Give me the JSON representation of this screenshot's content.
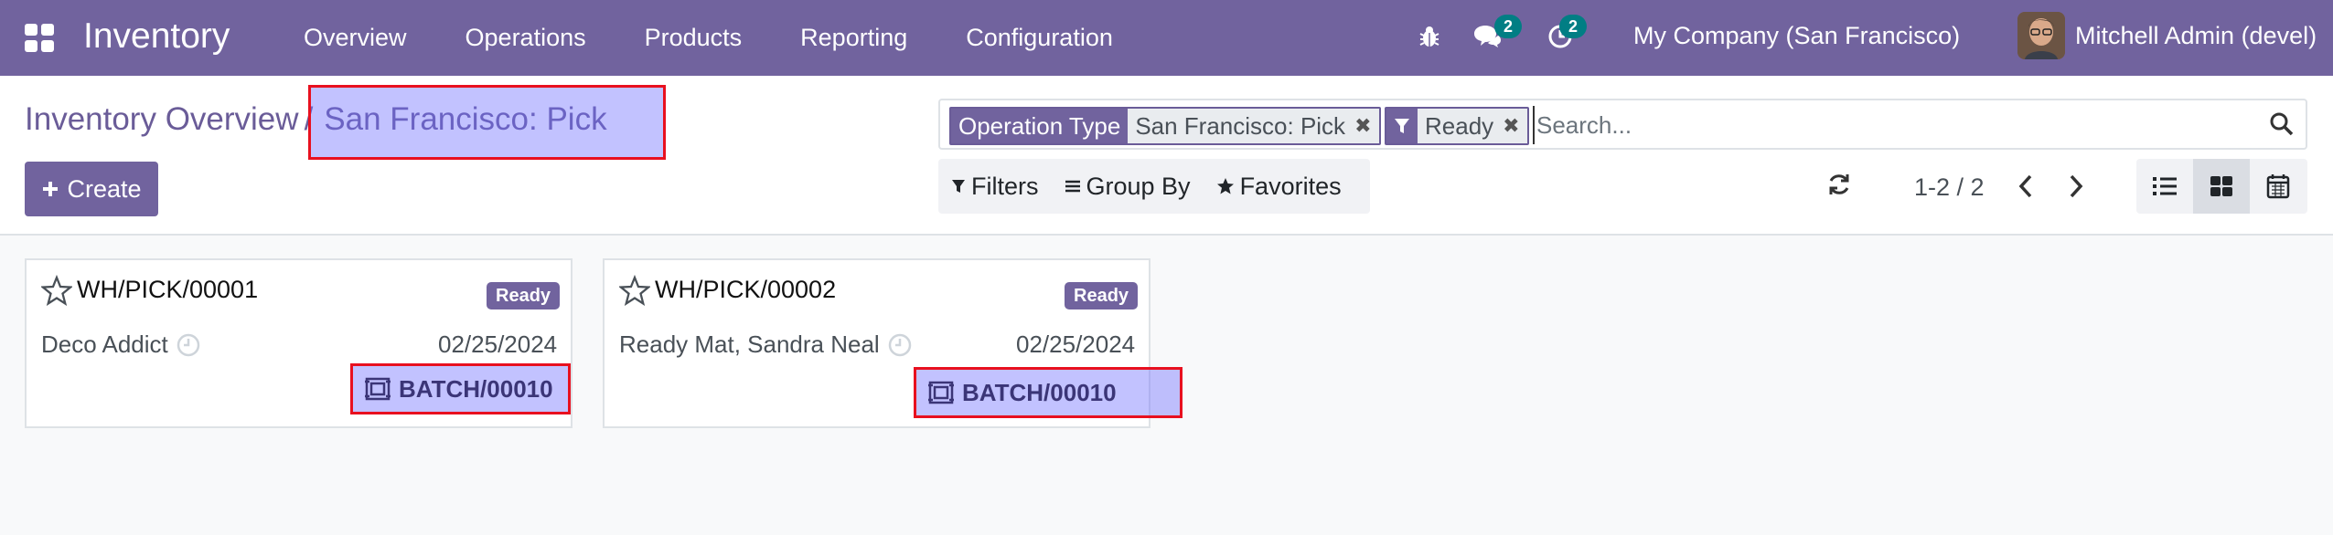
{
  "navbar": {
    "app_title": "Inventory",
    "menu": [
      "Overview",
      "Operations",
      "Products",
      "Reporting",
      "Configuration"
    ],
    "messages_count": "2",
    "activities_count": "2",
    "company": "My Company (San Francisco)",
    "user": "Mitchell Admin (devel)",
    "color": "#71639e"
  },
  "breadcrumb": {
    "parent": "Inventory Overview",
    "separator": "/",
    "current": "San Francisco: Pick"
  },
  "create_button": "Create",
  "search": {
    "facets": [
      {
        "label": "Operation Type",
        "value": "San Francisco: Pick",
        "icon": ""
      },
      {
        "label": "",
        "value": "Ready",
        "icon": "filter-icon"
      }
    ],
    "placeholder": "Search..."
  },
  "filter_bar": {
    "filters": "Filters",
    "group_by": "Group By",
    "favorites": "Favorites"
  },
  "pager": "1-2 / 2",
  "views": [
    "list-view",
    "kanban-view",
    "calendar-view"
  ],
  "active_view": "kanban-view",
  "cards": [
    {
      "ref": "WH/PICK/00001",
      "state": "Ready",
      "partner": "Deco Addict",
      "date": "02/25/2024",
      "batch": "BATCH/00010"
    },
    {
      "ref": "WH/PICK/00002",
      "state": "Ready",
      "partner": "Ready Mat, Sandra Neal",
      "date": "02/25/2024",
      "batch": "BATCH/00010"
    }
  ],
  "colors": {
    "accent": "#71639e",
    "highlight": "#e8101f",
    "badge": "#017e84"
  }
}
